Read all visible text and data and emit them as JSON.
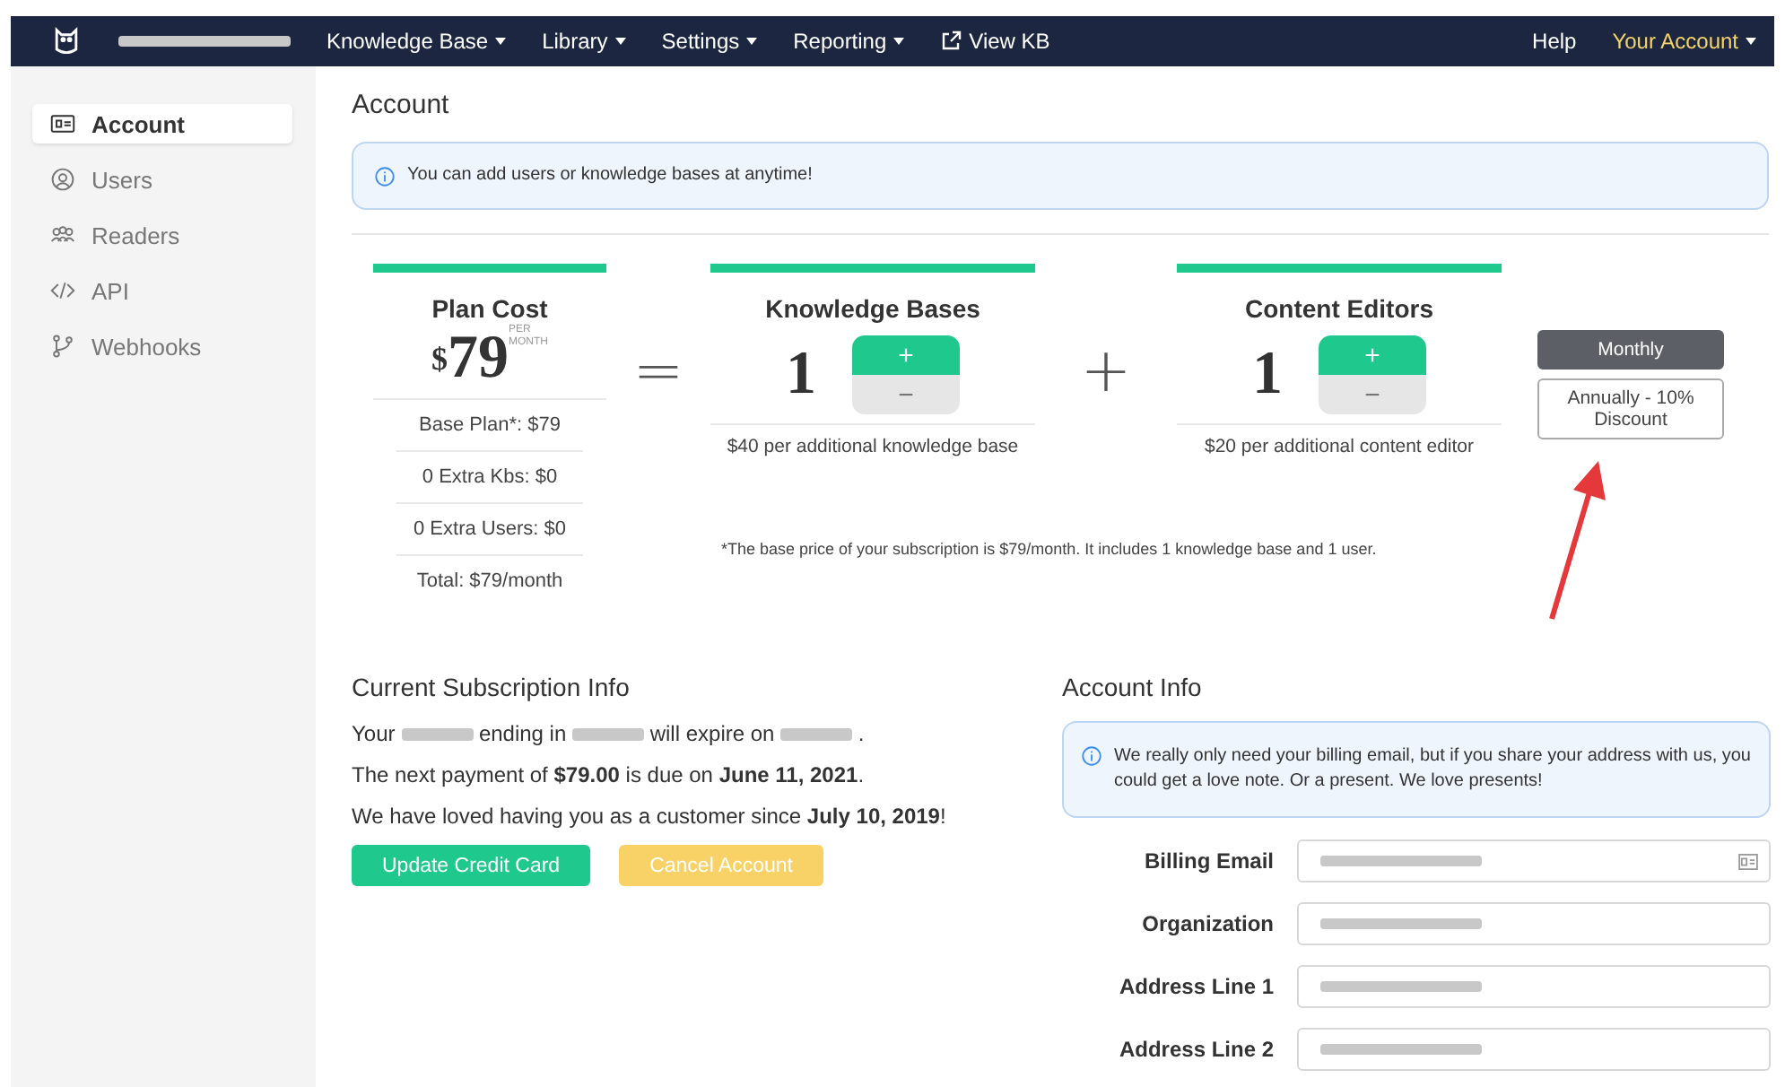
{
  "navbar": {
    "brand": {
      "kind": "redacted"
    },
    "menus": [
      {
        "label": "Knowledge Base",
        "kind": "dropdown"
      },
      {
        "label": "Library",
        "kind": "dropdown"
      },
      {
        "label": "Settings",
        "kind": "dropdown"
      },
      {
        "label": "Reporting",
        "kind": "dropdown"
      },
      {
        "label": "View KB",
        "kind": "external"
      }
    ],
    "right": [
      {
        "label": "Help",
        "kind": "link"
      },
      {
        "label": "Your Account",
        "kind": "account"
      }
    ]
  },
  "sidebar": {
    "items": [
      {
        "label": "Account",
        "selected": true
      },
      {
        "label": "Users",
        "selected": false
      },
      {
        "label": "Readers",
        "selected": false
      },
      {
        "label": "API",
        "selected": false
      },
      {
        "label": "Webhooks",
        "selected": false
      }
    ]
  },
  "page": {
    "title": "Account",
    "notice": "You can add users or knowledge bases at anytime!"
  },
  "plan": {
    "title": "Plan Cost",
    "price_symbol": "$",
    "price": "79",
    "per": "PER",
    "period": "MONTH",
    "lines": [
      "Base Plan*: $79",
      "0 Extra Kbs: $0",
      "0 Extra Users: $0",
      "Total: $79/month"
    ],
    "equals": "=",
    "plus": "+",
    "counters": [
      {
        "title": "Knowledge Bases",
        "count": "1",
        "inc": "+",
        "dec": "−",
        "note": "$40 per additional knowledge base"
      },
      {
        "title": "Content Editors",
        "count": "1",
        "inc": "+",
        "dec": "−",
        "note": "$20 per additional content editor"
      }
    ],
    "footnote": "*The base price of your subscription is $79/month. It includes 1 knowledge base and 1 user.",
    "billing": [
      {
        "label": "Monthly",
        "selected": true
      },
      {
        "label": "Annually - 10% Discount",
        "selected": false
      }
    ]
  },
  "subscription": {
    "title": "Current Subscription Info",
    "card_line": [
      {
        "kind": "text",
        "text": "Your"
      },
      {
        "kind": "redacted"
      },
      {
        "kind": "text",
        "text": "ending in"
      },
      {
        "kind": "redacted"
      },
      {
        "kind": "text",
        "text": "will expire on"
      },
      {
        "kind": "redacted"
      },
      {
        "kind": "text",
        "text": "."
      }
    ],
    "payment": "The next payment of **$79.00** is due on **June 11, 2021**.",
    "since": "We have loved having you as a customer since **July 10, 2019**!",
    "buttons": [
      {
        "label": "Update Credit Card",
        "kind": "primary"
      },
      {
        "label": "Cancel Account",
        "kind": "warning"
      }
    ]
  },
  "account_info": {
    "title": "Account Info",
    "notice": "We really only need your billing email, but if you share your address with us, you could get a love note. Or a present. We love presents!",
    "fields": [
      {
        "label": "Billing Email",
        "kind": "email"
      },
      {
        "label": "Organization",
        "kind": "text"
      },
      {
        "label": "Address Line 1",
        "kind": "text"
      },
      {
        "label": "Address Line 2",
        "kind": "text"
      }
    ]
  }
}
